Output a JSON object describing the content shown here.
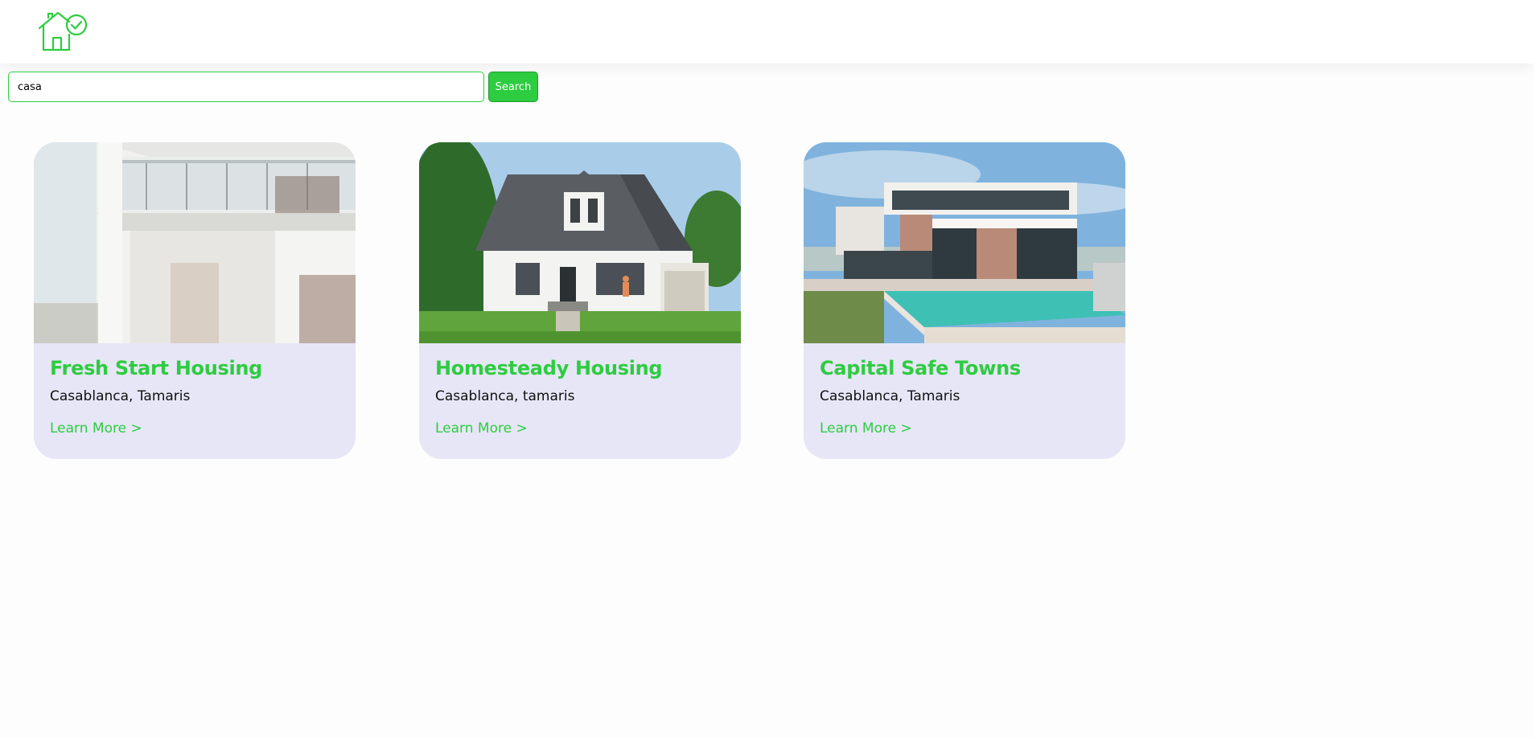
{
  "header": {
    "logo_icon": "house-check-icon",
    "brand_color": "#2ecc40"
  },
  "search": {
    "value": "casa",
    "placeholder": "",
    "button_label": "Search"
  },
  "listings": [
    {
      "title": "Fresh Start Housing",
      "location": "Casablanca, Tamaris",
      "link_label": "Learn More >",
      "image_icon": "modern-apartment-balcony-photo"
    },
    {
      "title": "Homesteady Housing",
      "location": "Casablanca, tamaris",
      "link_label": "Learn More >",
      "image_icon": "suburban-house-lawn-photo"
    },
    {
      "title": "Capital Safe Towns",
      "location": "Casablanca, Tamaris",
      "link_label": "Learn More >",
      "image_icon": "luxury-villa-pool-photo"
    }
  ],
  "colors": {
    "accent": "#2ecc40",
    "card_background": "#e6e6f7"
  }
}
